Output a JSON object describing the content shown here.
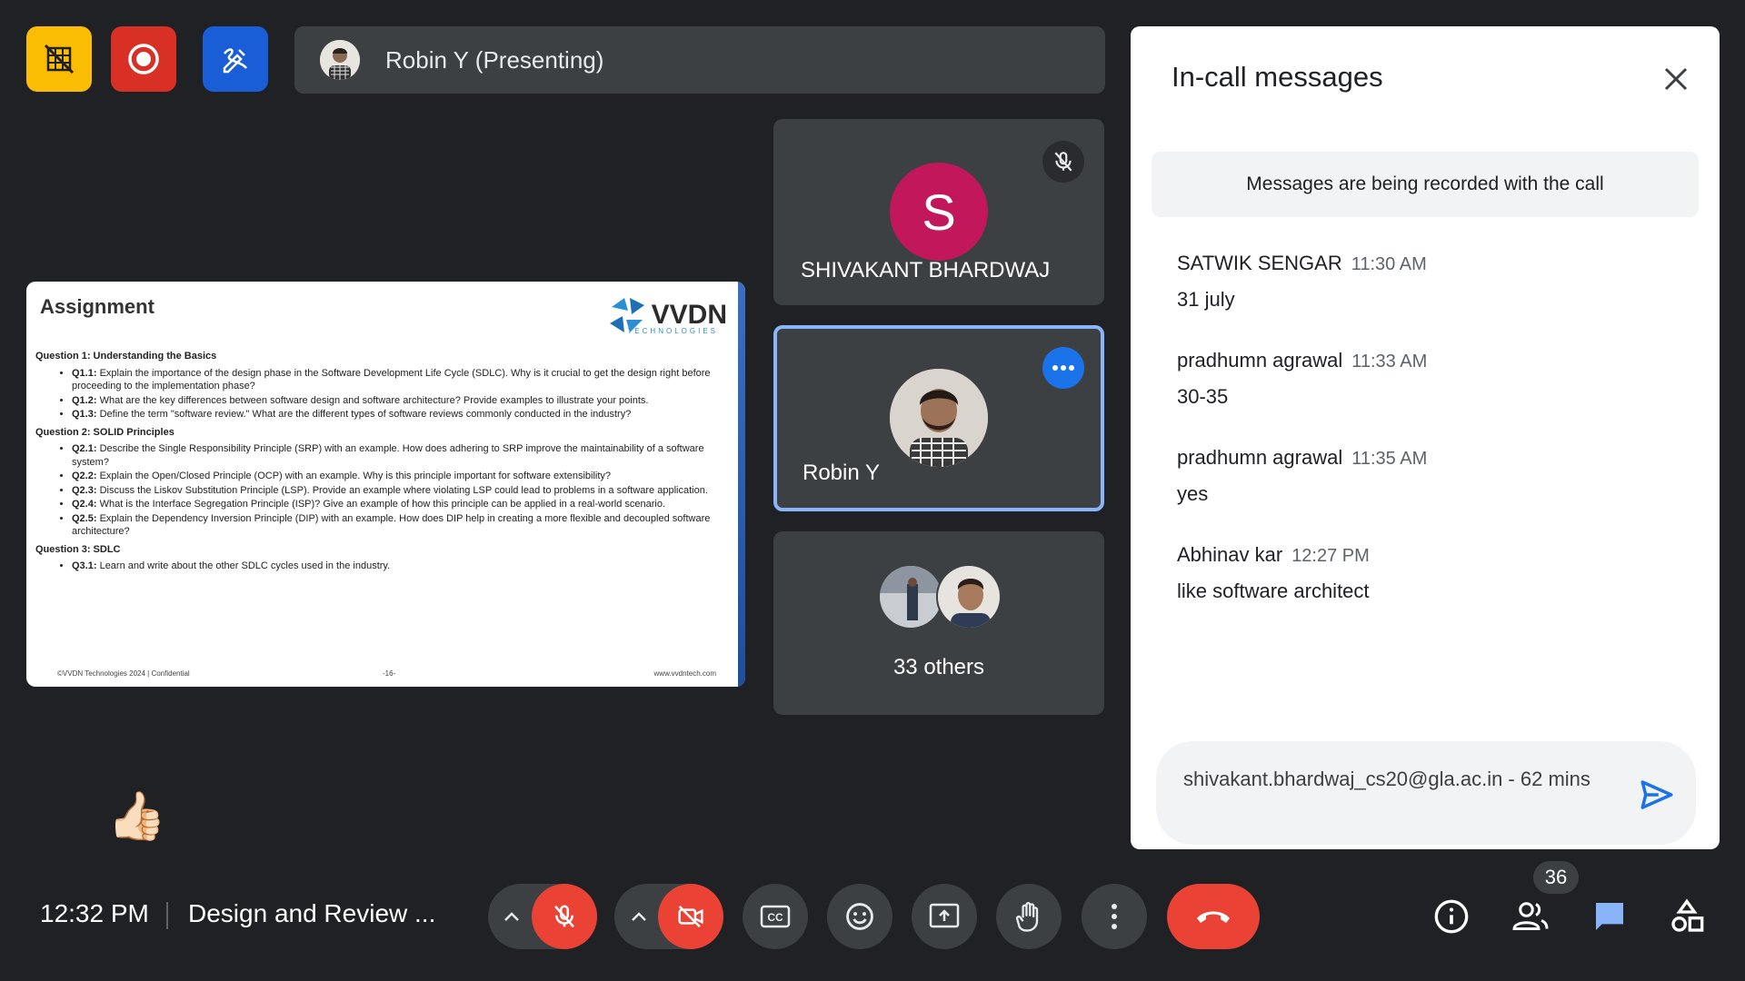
{
  "top_bar": {
    "presenting_title": "Robin Y (Presenting)"
  },
  "slide": {
    "title": "Assignment",
    "logo_text": "VVDN",
    "logo_sub": "TECHNOLOGIES",
    "sections": [
      {
        "heading": "Question 1: Understanding the Basics",
        "items": [
          {
            "label": "Q1.1:",
            "text": " Explain the importance of the design phase in the Software Development Life Cycle (SDLC). Why is it crucial to get the design right before proceeding to the implementation phase?"
          },
          {
            "label": "Q1.2:",
            "text": " What are the key differences between software design and software architecture? Provide examples to illustrate your points."
          },
          {
            "label": "Q1.3:",
            "text": " Define the term \"software review.\" What are the different types of software reviews commonly conducted in the industry?"
          }
        ]
      },
      {
        "heading": "Question 2: SOLID Principles",
        "items": [
          {
            "label": "Q2.1:",
            "text": " Describe the Single Responsibility Principle (SRP) with an example. How does adhering to SRP improve the maintainability of a software system?"
          },
          {
            "label": "Q2.2:",
            "text": " Explain the Open/Closed Principle (OCP) with an example. Why is this principle important for software extensibility?"
          },
          {
            "label": "Q2.3:",
            "text": " Discuss the Liskov Substitution Principle (LSP). Provide an example where violating LSP could lead to problems in a software application."
          },
          {
            "label": "Q2.4:",
            "text": " What is the Interface Segregation Principle (ISP)? Give an example of how this principle can be applied in a real-world scenario."
          },
          {
            "label": "Q2.5:",
            "text": " Explain the Dependency Inversion Principle (DIP) with an example. How does DIP help in creating a more flexible and decoupled software architecture?"
          }
        ]
      },
      {
        "heading": "Question 3: SDLC",
        "items": [
          {
            "label": "Q3.1:",
            "text": " Learn and write about the other SDLC cycles used in the industry."
          }
        ]
      }
    ],
    "footer_left": "©VVDN Technologies 2024 | Confidential",
    "footer_page": "-16-",
    "footer_right": "www.vvdntech.com"
  },
  "participants": {
    "shivakant": {
      "initial": "S",
      "name": "SHIVAKANT BHARDWAJ",
      "avatar_color": "#c2185b"
    },
    "robin": {
      "name": "Robin Y"
    },
    "others": {
      "label": "33 others"
    }
  },
  "reaction": {
    "emoji": "👍🏻"
  },
  "chat": {
    "title": "In-call messages",
    "notice": "Messages are being recorded with the call",
    "messages": [
      {
        "sender": "SATWIK SENGAR",
        "time": "11:30 AM",
        "text": "31 july"
      },
      {
        "sender": "pradhumn agrawal",
        "time": "11:33 AM",
        "text": "30-35"
      },
      {
        "sender": "pradhumn agrawal",
        "time": "11:35 AM",
        "text": "yes"
      },
      {
        "sender": "Abhinav kar",
        "time": "12:27 PM",
        "text": "like software architect"
      }
    ],
    "compose_value": "shivakant.bhardwaj_cs20@gla.ac.in - 62 mins"
  },
  "bottom_bar": {
    "time": "12:32 PM",
    "meeting_name": "Design and Review ...",
    "people_count": "36"
  },
  "colors": {
    "background": "#202124",
    "tile": "#3c4043",
    "accent_blue": "#1a73e8",
    "danger_red": "#ea4335",
    "active_border": "#8ab4f8"
  }
}
